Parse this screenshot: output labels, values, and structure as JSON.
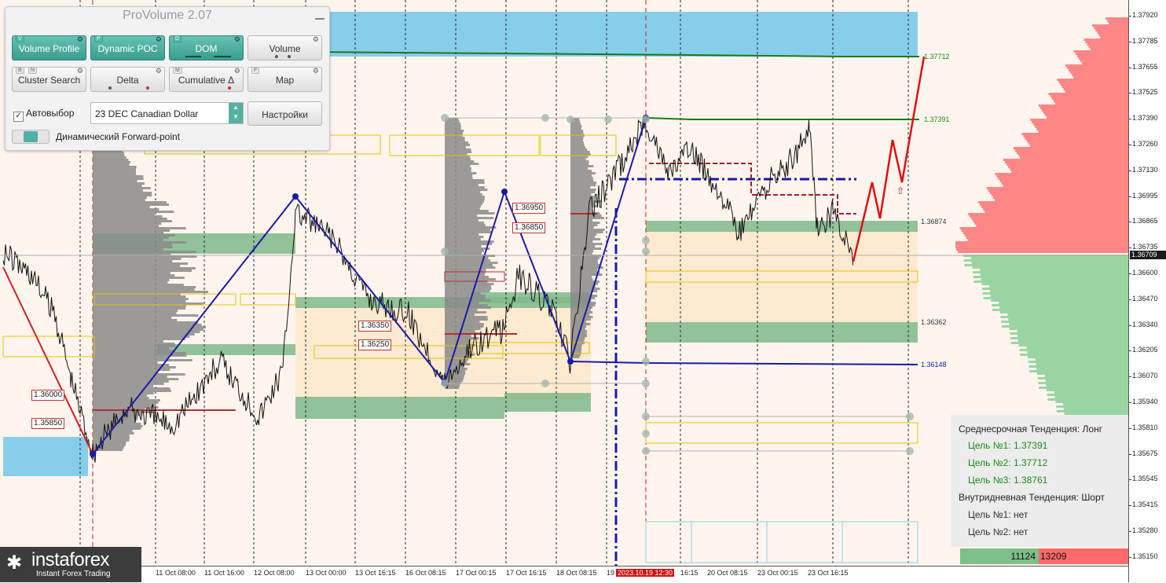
{
  "panel": {
    "title": "ProVolume 2.07",
    "buttons": [
      {
        "key": "V",
        "label": "Volume Profile",
        "active": true
      },
      {
        "key": "P",
        "label": "Dynamic POC",
        "active": true
      },
      {
        "key": "D",
        "label": "DOM",
        "active": true
      },
      {
        "key": "",
        "label": "Volume",
        "active": false
      },
      {
        "key": "B",
        "key2": "N",
        "label": "Cluster Search",
        "active": false
      },
      {
        "key": "",
        "label": "Delta",
        "active": false
      },
      {
        "key": "M",
        "label": "Cumulative Δ",
        "active": false
      },
      {
        "key": "F",
        "label": "Map",
        "active": false
      }
    ],
    "autoselect_label": "Автовыбор",
    "autoselect_checked": true,
    "instrument": "23 DEC Canadian Dollar",
    "settings_label": "Настройки",
    "forward_point_label": "Динамический Forward-point"
  },
  "price_axis": [
    "1.37920",
    "1.37785",
    "1.37655",
    "1.37525",
    "1.37390",
    "1.37260",
    "1.37130",
    "1.36995",
    "1.36865",
    "1.36735",
    "1.36600",
    "1.36470",
    "1.36340",
    "1.36205",
    "1.36070",
    "1.35940",
    "1.35810",
    "1.35675",
    "1.35545",
    "1.35415",
    "1.35280",
    "1.35150"
  ],
  "current_price": "1.36709",
  "time_axis": [
    {
      "label": "11 Oct 08:00",
      "hl": false
    },
    {
      "label": "11 Oct 16:00",
      "hl": false
    },
    {
      "label": "12 Oct 08:00",
      "hl": false
    },
    {
      "label": "13 Oct 00:00",
      "hl": false
    },
    {
      "label": "13 Oct 16:15",
      "hl": false
    },
    {
      "label": "16 Oct 08:15",
      "hl": false
    },
    {
      "label": "17 Oct 00:15",
      "hl": false
    },
    {
      "label": "17 Oct 16:15",
      "hl": false
    },
    {
      "label": "18 Oct 08:15",
      "hl": false
    },
    {
      "label": "19",
      "hl": false
    },
    {
      "label": "2023.10.19 12:30",
      "hl": true
    },
    {
      "label": "16:15",
      "hl": false
    },
    {
      "label": "20 Oct 08:15",
      "hl": false
    },
    {
      "label": "23 Oct 00:15",
      "hl": false
    },
    {
      "label": "23 Oct 16:15",
      "hl": false
    }
  ],
  "level_labels": {
    "t3": "1.37712",
    "t1": "1.37391",
    "lvl1": "1.36874",
    "lvl2": "1.36362",
    "lvl3": "1.36148"
  },
  "red_labels": [
    "1.36950",
    "1.36850",
    "1.36350",
    "1.36250",
    "1.36000",
    "1.35850"
  ],
  "info": {
    "mid_trend": "Среднесрочная Тенденция: Лонг",
    "mid_targets": [
      "Цель №1: 1.37391",
      "Цель №2: 1.37712",
      "Цель №3: 1.38761"
    ],
    "intraday_trend": "Внутридневная Тенденция: Шорт",
    "intraday_targets": [
      "Цель №1: нет",
      "Цель №2: нет"
    ]
  },
  "volume_bar": {
    "buy": "11124",
    "sell": "13209"
  },
  "logo": {
    "brand": "instaforex",
    "tagline": "Instant Forex Trading"
  },
  "colors": {
    "background": "#fff5ee",
    "zone_blue": "#87ceeb",
    "zone_green": "#7fb98a",
    "profile_grey": "#8a8a8a",
    "trend_blue": "#1a1aa8",
    "target_red": "#e01010",
    "buy_green": "#7fbf8a",
    "sell_red": "#ff6b6b"
  }
}
